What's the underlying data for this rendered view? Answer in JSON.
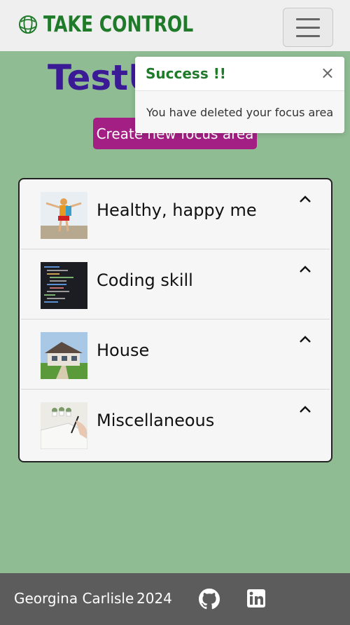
{
  "brand": {
    "name": "TAKE CONTROL",
    "logo_icon": "globe-ball-icon",
    "color": "#1f7a2a"
  },
  "nav": {
    "toggle_icon": "hamburger-menu-icon"
  },
  "page": {
    "title_visible": "TestU"
  },
  "actions": {
    "create_label": "Create new focus area",
    "create_color": "#a31f83"
  },
  "toast": {
    "title": "Success !!",
    "close_symbol": "×",
    "message": "You have deleted your focus area"
  },
  "focus_areas": [
    {
      "label": "Healthy, happy me",
      "image": "person-outdoors"
    },
    {
      "label": "Coding skill",
      "image": "code-editor"
    },
    {
      "label": "House",
      "image": "house"
    },
    {
      "label": "Miscellaneous",
      "image": "writing-notebook"
    }
  ],
  "footer": {
    "name": "Georgina Carlisle",
    "year": "2024",
    "icons": [
      "github-icon",
      "linkedin-icon"
    ]
  },
  "colors": {
    "background": "#8fbc93",
    "title": "#3b1a96",
    "footer": "#5c5c5c"
  }
}
